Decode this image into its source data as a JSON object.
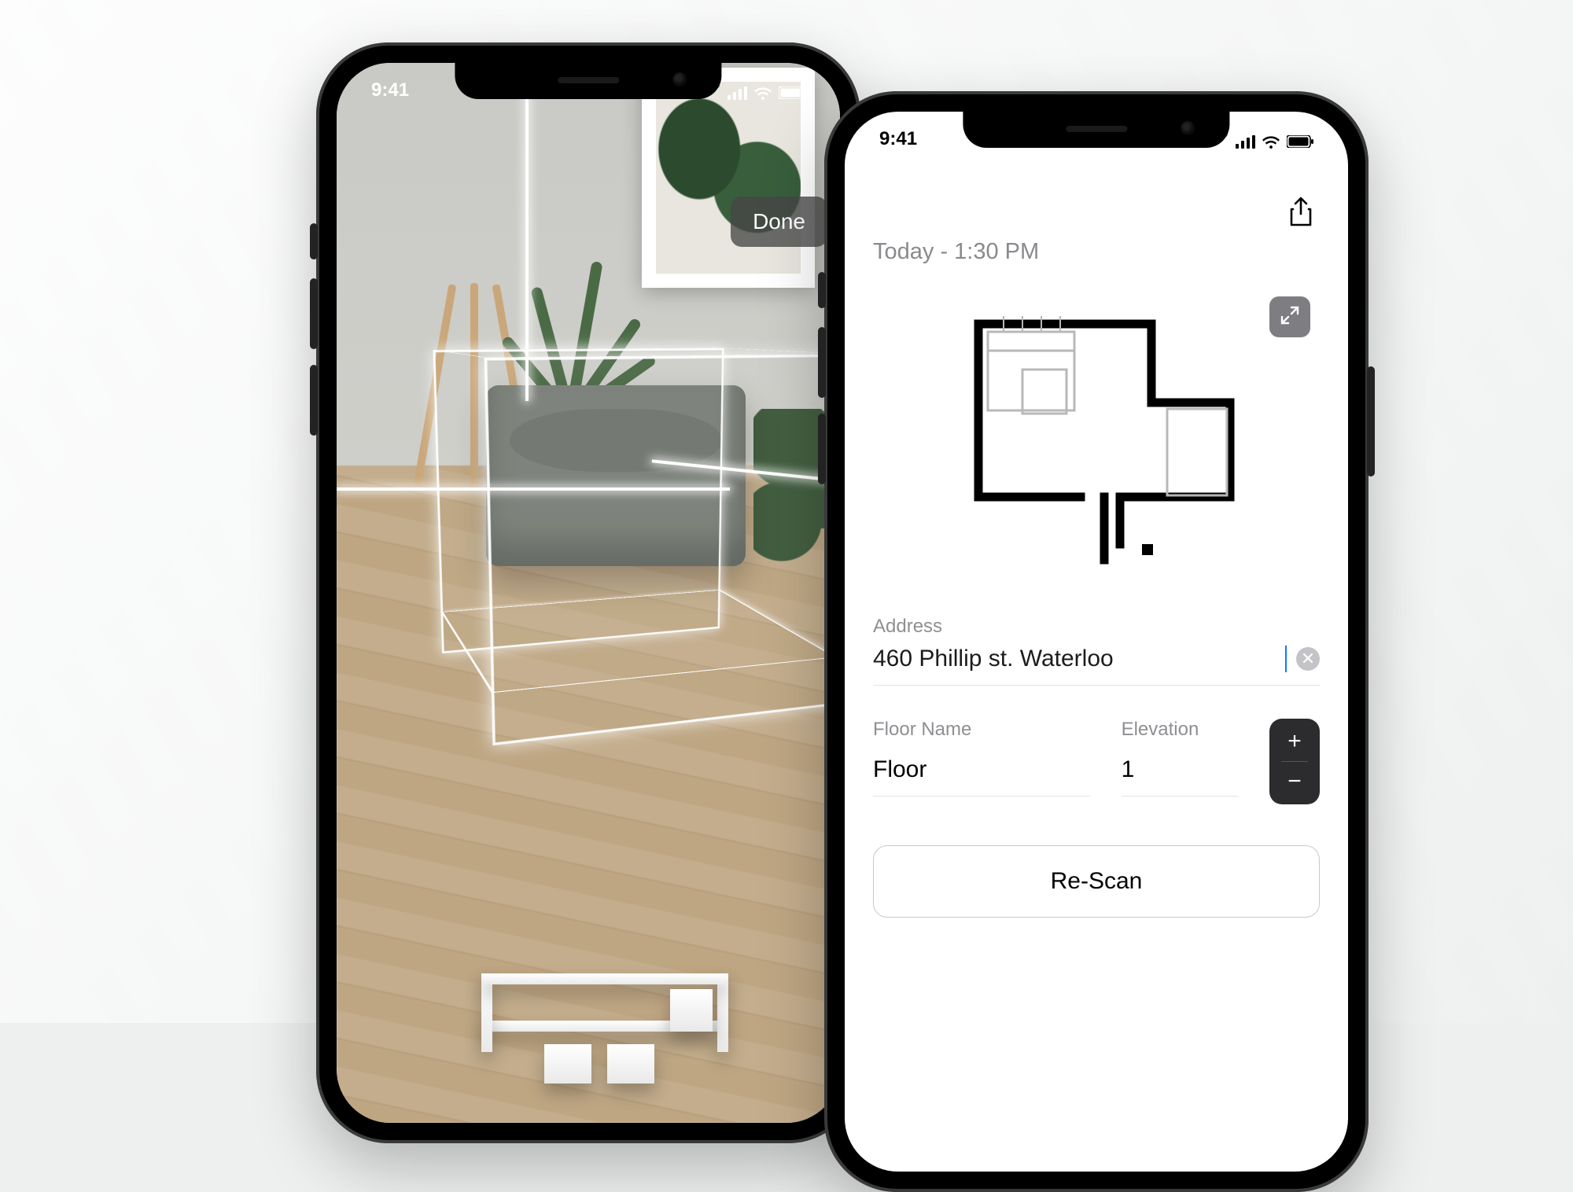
{
  "status": {
    "time": "9:41"
  },
  "phoneA": {
    "done_label": "Done"
  },
  "phoneB": {
    "timestamp": "Today - 1:30 PM",
    "address": {
      "label": "Address",
      "value": "460 Phillip st. Waterloo"
    },
    "floor_name": {
      "label": "Floor Name",
      "value": "Floor"
    },
    "elevation": {
      "label": "Elevation",
      "value": "1"
    },
    "rescan_label": "Re-Scan",
    "stepper": {
      "plus": "+",
      "minus": "−"
    }
  }
}
